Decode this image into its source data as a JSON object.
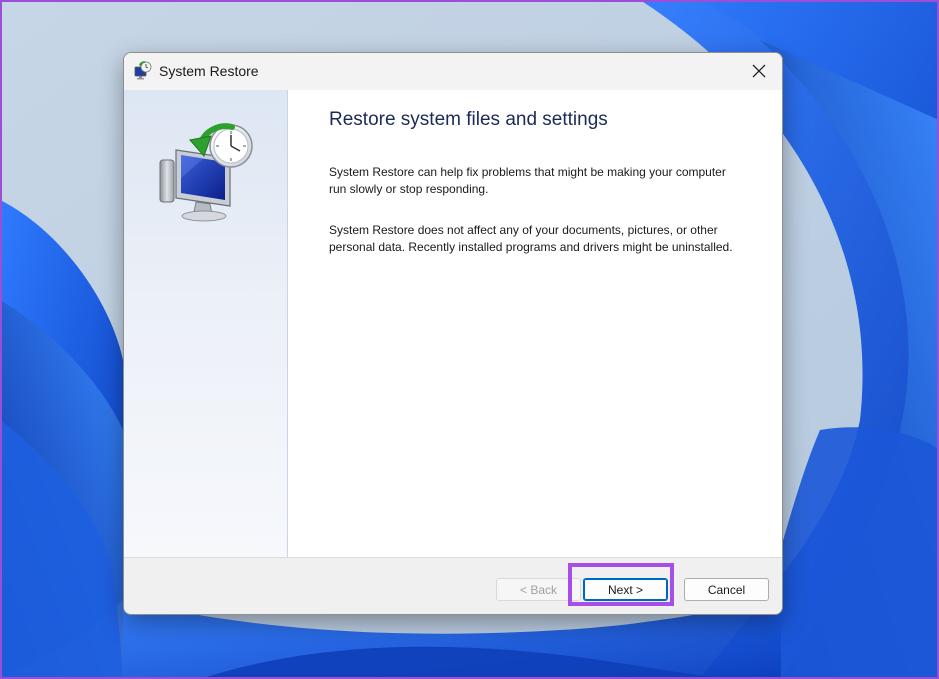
{
  "window": {
    "title": "System Restore",
    "close_label": "✕"
  },
  "page": {
    "heading": "Restore system files and settings",
    "paragraph1": "System Restore can help fix problems that might be making your computer run slowly or stop responding.",
    "paragraph2": "System Restore does not affect any of your documents, pictures, or other personal data. Recently installed programs and drivers might be uninstalled."
  },
  "buttons": {
    "back": "< Back",
    "next": "Next >",
    "cancel": "Cancel"
  },
  "colors": {
    "highlight": "#a64ee8",
    "heading_text": "#1b2a57",
    "accent_border": "#0067c0",
    "wallpaper_blue": "#1a5be0"
  },
  "icons": {
    "app": "system-restore-icon",
    "hero": "system-restore-monitor-clock-icon",
    "close": "close-icon"
  }
}
